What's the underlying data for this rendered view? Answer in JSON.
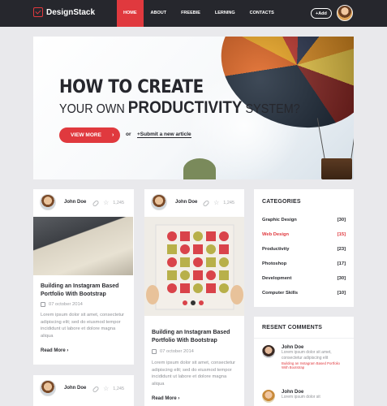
{
  "header": {
    "logo": "DesignStack",
    "nav": [
      "HOME",
      "ABOUT",
      "FREEBIE",
      "LERNING",
      "CONTACTS"
    ],
    "add_label": "+Add"
  },
  "hero": {
    "line1": "HOW TO CREATE",
    "line2_prefix": "YOUR OWN",
    "line2_bold": "PRODUCTIVITY",
    "line2_suffix": "SYSTEM?",
    "cta": "VIEW MORE",
    "or": "or",
    "submit": "+Submit a new article"
  },
  "posts": [
    {
      "author": "John Doe",
      "likes": "1,245",
      "title": "Building an Instagram Based Portfolio With Bootstrap",
      "date": "07 october 2014",
      "excerpt": "Lorem ipsum dolor sit amet, consectetur adipiscing elit; sed do eiusmod tempor incididunt ut labore et dolore magna aliqua",
      "read_more": "Read More"
    },
    {
      "author": "John Doe",
      "likes": "1,245",
      "title": "Building an Instagram Based Portfolio With Bootstrap",
      "date": "07 october 2014",
      "excerpt": "Lorem ipsum dolor sit amet, consectetur adipiscing elit; sed do eiusmod tempor incididunt ut labore et dolore magna aliqua",
      "read_more": "Read More"
    },
    {
      "author": "John Doe",
      "likes": "1,245"
    }
  ],
  "categories": {
    "title": "CATEGORIES",
    "items": [
      {
        "name": "Graphic Design",
        "count": "[30]"
      },
      {
        "name": "Web Design",
        "count": "[15]"
      },
      {
        "name": "Productivity",
        "count": "[23]"
      },
      {
        "name": "Photoshop",
        "count": "[17]"
      },
      {
        "name": "Development",
        "count": "[30]"
      },
      {
        "name": "Computer Skills",
        "count": "[10]"
      }
    ]
  },
  "recent_comments": {
    "title": "RESENT COMMENTS",
    "items": [
      {
        "name": "John Doe",
        "text": "Lorem ipsum dolor sit amet, consectetur adipiscing elit",
        "link": "Building an Instagram Based Portfolio With Bootstrap"
      },
      {
        "name": "John Doe",
        "text": "Lorem ipsum dolor sit"
      }
    ]
  },
  "colors": {
    "accent": "#e0393e",
    "header_bg": "#26272d",
    "page_bg": "#e9e9ec"
  }
}
